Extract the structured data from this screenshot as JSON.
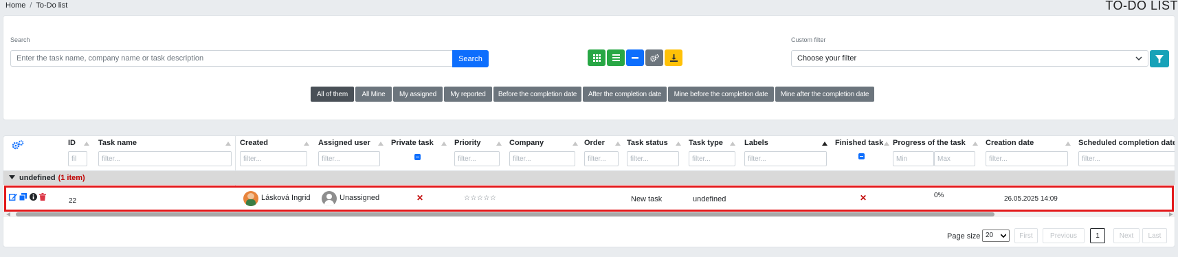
{
  "breadcrumb": {
    "home": "Home",
    "separator": "/",
    "current": "To-Do list"
  },
  "page_title": "TO-DO LIST",
  "search": {
    "label": "Search",
    "placeholder": "Enter the task name, company name or task description",
    "value": "",
    "button_label": "Search"
  },
  "toolbar": {
    "buttons": [
      {
        "icon": "grid-icon",
        "color": "#28a745"
      },
      {
        "icon": "list-icon",
        "color": "#28a745"
      },
      {
        "icon": "minus-icon",
        "color": "#0d6efd"
      },
      {
        "icon": "cogs-icon",
        "color": "#6c757d"
      },
      {
        "icon": "download-icon",
        "color": "#ffc107"
      }
    ]
  },
  "custom_filter": {
    "label": "Custom filter",
    "selected": "Choose your filter",
    "filter_button_color": "#17a2b8"
  },
  "quick_filters": [
    {
      "label": "All of them",
      "active": true
    },
    {
      "label": "All Mine",
      "active": false
    },
    {
      "label": "My assigned",
      "active": false
    },
    {
      "label": "My reported",
      "active": false
    },
    {
      "label": "Before the completion date",
      "active": false
    },
    {
      "label": "After the completion date",
      "active": false
    },
    {
      "label": "Mine before the completion date",
      "active": false
    },
    {
      "label": "Mine after the completion date",
      "active": false
    }
  ],
  "table": {
    "columns": {
      "id": "ID",
      "task_name": "Task name",
      "created": "Created",
      "assigned_user": "Assigned user",
      "private_task": "Private task",
      "priority": "Priority",
      "company": "Company",
      "order": "Order",
      "task_status": "Task status",
      "task_type": "Task type",
      "labels": "Labels",
      "finished_task": "Finished task",
      "progress": "Progress of the task",
      "creation_date": "Creation date",
      "scheduled_completion": "Scheduled completion date"
    },
    "filter_placeholders": {
      "id": "fil",
      "generic": "filter...",
      "progress_min": "Min",
      "progress_max": "Max"
    },
    "group": {
      "name": "undefined",
      "count": "(1 item)"
    },
    "rows": [
      {
        "id": "22",
        "created_by": "Lásková Ingrid",
        "assigned_user": "Unassigned",
        "private_task": "✕",
        "priority": "☆☆☆☆☆",
        "task_status": "New task",
        "task_type": "undefined",
        "finished_task": "✕",
        "progress": "0%",
        "creation_date": "26.05.2025 14:09"
      }
    ]
  },
  "pagination": {
    "page_size_label": "Page size",
    "page_size": "20",
    "first": "First",
    "previous": "Previous",
    "current_page": "1",
    "next": "Next",
    "last": "Last"
  },
  "colors": {
    "highlight": "#e3191b",
    "primary": "#0d6efd",
    "danger": "#c00000"
  }
}
